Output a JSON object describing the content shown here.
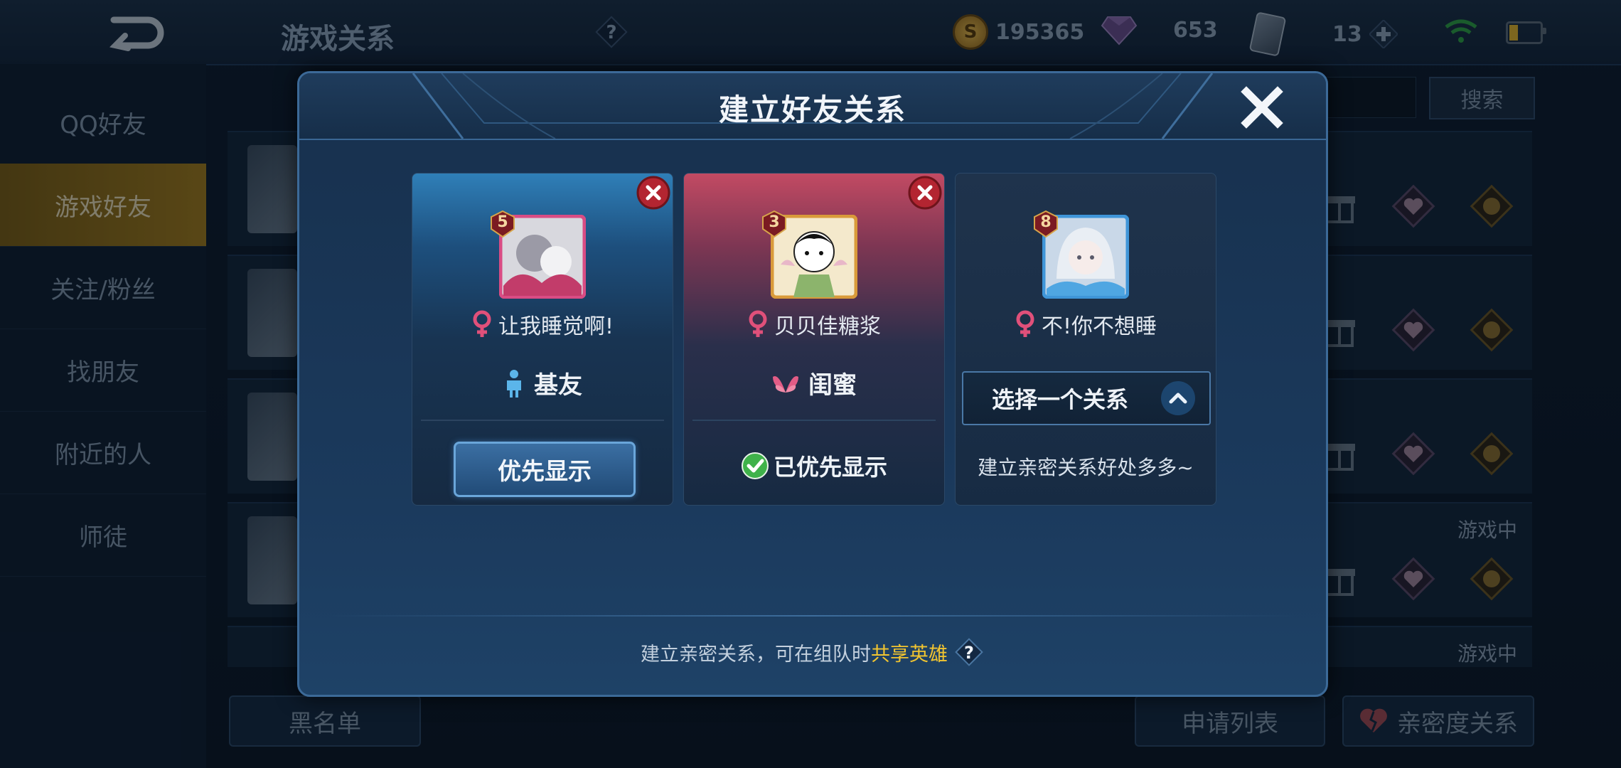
{
  "header": {
    "title": "游戏关系",
    "gold": "195365",
    "diamonds": "653",
    "cards": "13"
  },
  "sidebar": {
    "items": [
      {
        "label": "QQ好友"
      },
      {
        "label": "游戏好友"
      },
      {
        "label": "关注/粉丝"
      },
      {
        "label": "找朋友"
      },
      {
        "label": "附近的人"
      },
      {
        "label": "师徒"
      }
    ],
    "active_index": 1
  },
  "search": {
    "button_label": "搜索"
  },
  "friend_list": {
    "status_labels": [
      "游戏中",
      "游戏中"
    ]
  },
  "bottom": {
    "blacklist_label": "黑名单",
    "request_list_label": "申请列表",
    "intimacy_label": "亲密度关系"
  },
  "modal": {
    "title": "建立好友关系",
    "cards": [
      {
        "level": "5",
        "name": "让我睡觉啊!",
        "gender": "female",
        "relation": "基友",
        "relation_icon": "person-icon",
        "action_label": "优先显示",
        "theme": "#2f7fb8"
      },
      {
        "level": "3",
        "name": "贝贝佳糖浆",
        "gender": "female",
        "relation": "闺蜜",
        "relation_icon": "butterfly-icon",
        "status_label": "已优先显示",
        "theme": "#c24a63"
      },
      {
        "level": "8",
        "name": "不!你不想睡",
        "gender": "female",
        "select_label": "选择一个关系",
        "benefit_text": "建立亲密关系好处多多~"
      }
    ],
    "footer": {
      "prefix": "建立亲密关系，可在组队时",
      "highlight": "共享英雄"
    }
  },
  "colors": {
    "accent_blue": "#3c6a98",
    "highlight_gold": "#f2c530",
    "female_pink": "#e0507a",
    "check_green": "#3fb24a",
    "close_red": "#b32531"
  }
}
